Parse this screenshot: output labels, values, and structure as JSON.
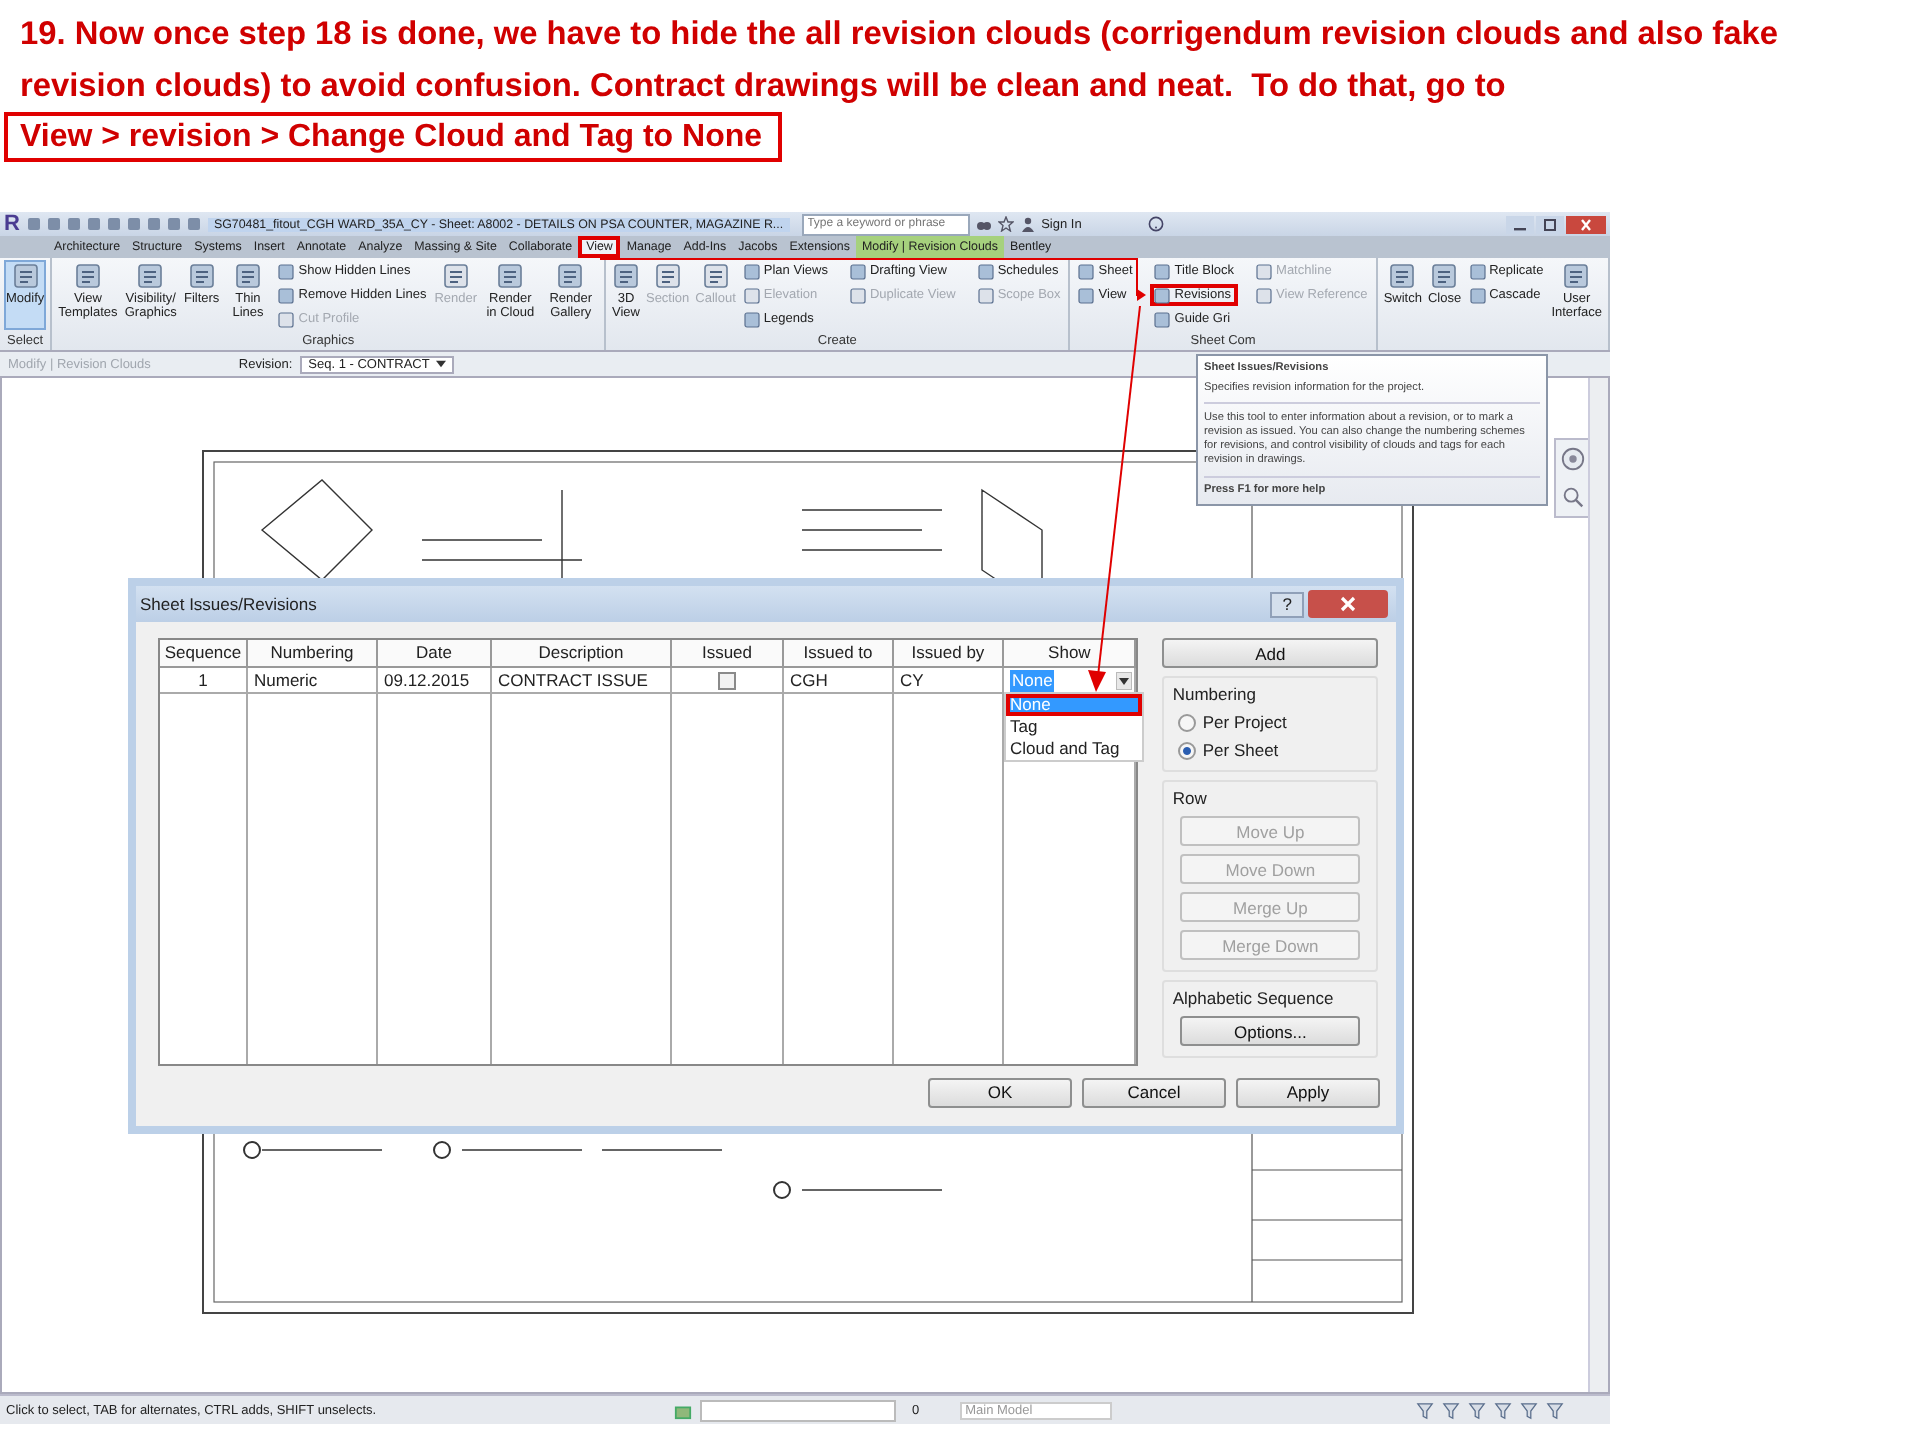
{
  "instruction": {
    "text": "19. Now once step 18 is done, we have to hide the all revision clouds (corrigendum revision clouds and also fake revision clouds) to avoid confusion. Contract drawings will be clean and neat.  To do that, go to",
    "path": "View > revision > Change Cloud and Tag to None"
  },
  "app": {
    "logo": "R",
    "title": "SG70481_fitout_CGH WARD_35A_CY - Sheet: A8002 - DETAILS ON PSA COUNTER, MAGAZINE R...",
    "search": {
      "placeholder": "Type a keyword or phrase"
    },
    "sign_in": "Sign In"
  },
  "tabs": [
    {
      "label": "Architecture",
      "selected": false,
      "kind": "tab",
      "highlighted": false
    },
    {
      "label": "Structure",
      "selected": false,
      "kind": "tab",
      "highlighted": false
    },
    {
      "label": "Systems",
      "selected": false,
      "kind": "tab",
      "highlighted": false
    },
    {
      "label": "Insert",
      "selected": false,
      "kind": "tab",
      "highlighted": false
    },
    {
      "label": "Annotate",
      "selected": false,
      "kind": "tab",
      "highlighted": false
    },
    {
      "label": "Analyze",
      "selected": false,
      "kind": "tab",
      "highlighted": false
    },
    {
      "label": "Massing & Site",
      "selected": false,
      "kind": "tab",
      "highlighted": false
    },
    {
      "label": "Collaborate",
      "selected": false,
      "kind": "tab",
      "highlighted": false
    },
    {
      "label": "View",
      "selected": true,
      "kind": "tab",
      "highlighted": true
    },
    {
      "label": "Manage",
      "selected": false,
      "kind": "tab",
      "highlighted": false
    },
    {
      "label": "Add-Ins",
      "selected": false,
      "kind": "tab",
      "highlighted": false
    },
    {
      "label": "Jacobs",
      "selected": false,
      "kind": "tab",
      "highlighted": false
    },
    {
      "label": "Extensions",
      "selected": false,
      "kind": "tab",
      "highlighted": false
    },
    {
      "label": "Modify | Revision Clouds",
      "selected": false,
      "kind": "context",
      "highlighted": false
    },
    {
      "label": "Bentley",
      "selected": false,
      "kind": "tab",
      "highlighted": false
    }
  ],
  "ribbon": {
    "groups": [
      {
        "label": "Select",
        "columns": [
          {
            "kind": "large",
            "tools": [
              {
                "label": "Modify",
                "selected": true,
                "disabled": false,
                "highlighted": false
              }
            ]
          }
        ]
      },
      {
        "label": "Graphics",
        "columns": [
          {
            "kind": "large",
            "tools": [
              {
                "label": "View Templates",
                "selected": false,
                "disabled": false,
                "highlighted": false
              }
            ]
          },
          {
            "kind": "large",
            "tools": [
              {
                "label": "Visibility/ Graphics",
                "selected": false,
                "disabled": false,
                "highlighted": false
              }
            ]
          },
          {
            "kind": "large",
            "tools": [
              {
                "label": "Filters",
                "selected": false,
                "disabled": false,
                "highlighted": false
              }
            ]
          },
          {
            "kind": "large",
            "tools": [
              {
                "label": "Thin Lines",
                "selected": false,
                "disabled": false,
                "highlighted": false
              }
            ]
          },
          {
            "kind": "stack",
            "tools": [
              {
                "label": "Show Hidden Lines",
                "selected": false,
                "disabled": false,
                "highlighted": false
              },
              {
                "label": "Remove Hidden Lines",
                "selected": false,
                "disabled": false,
                "highlighted": false
              },
              {
                "label": "Cut Profile",
                "selected": false,
                "disabled": true,
                "highlighted": false
              }
            ]
          },
          {
            "kind": "large",
            "tools": [
              {
                "label": "Render",
                "selected": false,
                "disabled": true,
                "highlighted": false
              }
            ]
          },
          {
            "kind": "large",
            "tools": [
              {
                "label": "Render in Cloud",
                "selected": false,
                "disabled": false,
                "highlighted": false
              }
            ]
          },
          {
            "kind": "large",
            "tools": [
              {
                "label": "Render Gallery",
                "selected": false,
                "disabled": false,
                "highlighted": false
              }
            ]
          }
        ]
      },
      {
        "label": "Create",
        "columns": [
          {
            "kind": "large",
            "tools": [
              {
                "label": "3D View",
                "selected": false,
                "disabled": false,
                "highlighted": false
              }
            ]
          },
          {
            "kind": "large",
            "tools": [
              {
                "label": "Section",
                "selected": false,
                "disabled": true,
                "highlighted": false
              }
            ]
          },
          {
            "kind": "large",
            "tools": [
              {
                "label": "Callout",
                "selected": false,
                "disabled": true,
                "highlighted": false
              }
            ]
          },
          {
            "kind": "stack",
            "tools": [
              {
                "label": "Plan Views",
                "selected": false,
                "disabled": false,
                "highlighted": false
              },
              {
                "label": "Elevation",
                "selected": false,
                "disabled": true,
                "highlighted": false
              },
              {
                "label": "Legends",
                "selected": false,
                "disabled": false,
                "highlighted": false
              }
            ]
          },
          {
            "kind": "stack",
            "tools": [
              {
                "label": "Drafting View",
                "selected": false,
                "disabled": false,
                "highlighted": false
              },
              {
                "label": "Duplicate View",
                "selected": false,
                "disabled": true,
                "highlighted": false
              }
            ]
          },
          {
            "kind": "stack",
            "tools": [
              {
                "label": "Schedules",
                "selected": false,
                "disabled": false,
                "highlighted": false
              },
              {
                "label": "Scope Box",
                "selected": false,
                "disabled": true,
                "highlighted": false
              }
            ]
          }
        ]
      },
      {
        "label": "Sheet Com",
        "columns": [
          {
            "kind": "stack",
            "tools": [
              {
                "label": "Sheet",
                "selected": false,
                "disabled": false,
                "highlighted": false
              },
              {
                "label": "View",
                "selected": false,
                "disabled": false,
                "highlighted": false
              }
            ]
          },
          {
            "kind": "stack",
            "tools": [
              {
                "label": "Title Block",
                "selected": false,
                "disabled": false,
                "highlighted": false
              },
              {
                "label": "Revisions",
                "selected": false,
                "disabled": false,
                "highlighted": true
              },
              {
                "label": "Guide Gri",
                "selected": false,
                "disabled": false,
                "highlighted": false
              }
            ]
          },
          {
            "kind": "stack",
            "tools": [
              {
                "label": "Matchline",
                "selected": false,
                "disabled": true,
                "highlighted": false
              },
              {
                "label": "View Reference",
                "selected": false,
                "disabled": true,
                "highlighted": false
              }
            ]
          }
        ]
      },
      {
        "columns": [
          {
            "kind": "large",
            "tools": [
              {
                "label": "Switch",
                "selected": false,
                "disabled": false,
                "highlighted": false
              }
            ]
          },
          {
            "kind": "large",
            "tools": [
              {
                "label": "Close",
                "selected": false,
                "disabled": false,
                "highlighted": false
              }
            ]
          },
          {
            "kind": "stack",
            "tools": [
              {
                "label": "Replicate",
                "selected": false,
                "disabled": false,
                "highlighted": false
              },
              {
                "label": "Cascade",
                "selected": false,
                "disabled": false,
                "highlighted": false
              }
            ]
          },
          {
            "kind": "large",
            "tools": [
              {
                "label": "User Interface",
                "selected": false,
                "disabled": false,
                "highlighted": false
              }
            ]
          }
        ]
      }
    ]
  },
  "options_bar": {
    "context": "Modify | Revision Clouds",
    "revision_label": "Revision:",
    "revision_value": "Seq. 1 - CONTRACT"
  },
  "tooltip": {
    "title": "Sheet Issues/Revisions",
    "summary": "Specifies revision information for the project.",
    "details": "Use this tool to enter information about a revision, or to mark a revision as issued. You can also change the numbering schemes for revisions, and control visibility of clouds and tags for each revision in drawings.",
    "help": "Press F1 for more help"
  },
  "dialog": {
    "title": "Sheet Issues/Revisions",
    "help": "?",
    "columns": [
      "Sequence",
      "Numbering",
      "Date",
      "Description",
      "Issued",
      "Issued to",
      "Issued by",
      "Show"
    ],
    "rows": [
      {
        "sequence": "1",
        "numbering": "Numeric",
        "date": "09.12.2015",
        "description": "CONTRACT ISSUE",
        "issued": false,
        "issued_to": "CGH",
        "issued_by": "CY",
        "show": "None"
      }
    ],
    "show_options": [
      {
        "label": "None",
        "selected": true,
        "highlighted": true
      },
      {
        "label": "Tag",
        "selected": false,
        "highlighted": false
      },
      {
        "label": "Cloud and Tag",
        "selected": false,
        "highlighted": false
      }
    ],
    "add": "Add",
    "numbering": {
      "label": "Numbering",
      "options": [
        {
          "label": "Per Project",
          "selected": false
        },
        {
          "label": "Per Sheet",
          "selected": true
        }
      ]
    },
    "row": {
      "label": "Row",
      "buttons": [
        {
          "label": "Move Up",
          "disabled": true
        },
        {
          "label": "Move Down",
          "disabled": true
        },
        {
          "label": "Merge Up",
          "disabled": true
        },
        {
          "label": "Merge Down",
          "disabled": true
        }
      ]
    },
    "alphabetic": {
      "label": "Alphabetic Sequence",
      "button": "Options..."
    },
    "buttons": [
      "OK",
      "Cancel",
      "Apply"
    ]
  },
  "status_bar": {
    "hint": "Click to select, TAB for alternates, CTRL adds, SHIFT unselects.",
    "count": "0",
    "model": "Main Model"
  }
}
